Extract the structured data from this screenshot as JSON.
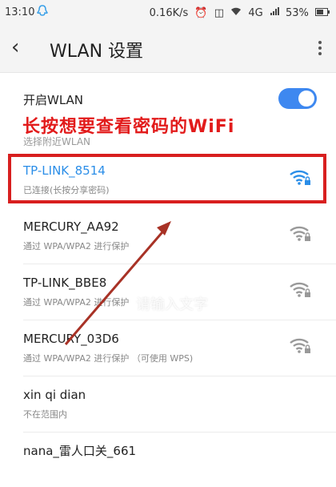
{
  "status_bar": {
    "time": "13:10",
    "speed": "0.16K/s",
    "network": "4G",
    "battery": "53%"
  },
  "app_bar": {
    "back_icon": "back-chevron",
    "title": "WLAN 设置",
    "more_icon": "more-vertical"
  },
  "wlan_toggle": {
    "label": "开启WLAN",
    "enabled": true,
    "color": "#3e88f0"
  },
  "section_label": "选择附近WLAN",
  "annotation": {
    "text": "长按想要查看密码的WiFi",
    "color": "#e21b1b",
    "watermark": "请输入文字"
  },
  "networks": [
    {
      "ssid": "TP-LINK_8514",
      "status": "已连接(长按分享密码)",
      "connected": true,
      "icon": "wifi-lock-icon"
    },
    {
      "ssid": "MERCURY_AA92",
      "status": "通过 WPA/WPA2 进行保护",
      "connected": false,
      "icon": "wifi-lock-icon"
    },
    {
      "ssid": "TP-LINK_BBE8",
      "status": "通过 WPA/WPA2 进行保护",
      "connected": false,
      "icon": "wifi-lock-icon"
    },
    {
      "ssid": "MERCURY_03D6",
      "status": "通过 WPA/WPA2 进行保护 （可使用 WPS)",
      "connected": false,
      "icon": "wifi-lock-icon"
    },
    {
      "ssid": "xin qi dian",
      "status": "不在范围内",
      "connected": false,
      "icon": ""
    },
    {
      "ssid": "nana_雷人口关_661",
      "status": "",
      "connected": false,
      "icon": ""
    }
  ]
}
